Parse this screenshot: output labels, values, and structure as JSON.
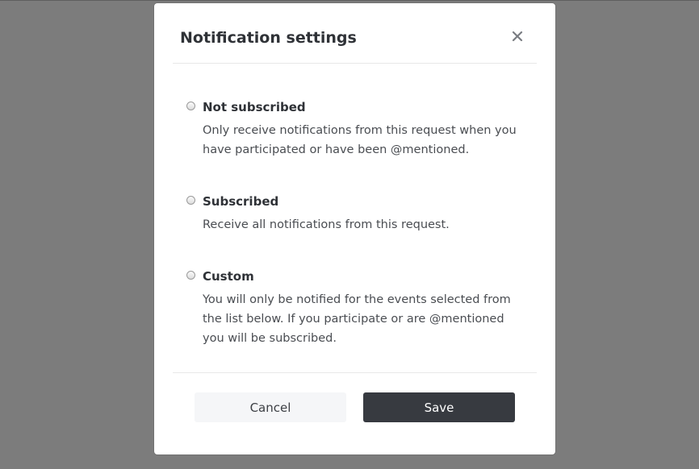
{
  "dialog": {
    "title": "Notification settings",
    "close_icon": "close-icon"
  },
  "options": [
    {
      "label": "Not subscribed",
      "description": "Only receive notifications from this request when you have participated or have been @mentioned.",
      "selected": false
    },
    {
      "label": "Subscribed",
      "description": "Receive all notifications from this request.",
      "selected": false
    },
    {
      "label": "Custom",
      "description": "You will only be notified for the events selected from the list below. If you participate or are @mentioned you will be subscribed.",
      "selected": false
    }
  ],
  "footer": {
    "cancel_label": "Cancel",
    "save_label": "Save"
  },
  "colors": {
    "backdrop": "#7c7c7c",
    "primary_button": "#373a40",
    "secondary_button": "#f5f6f8"
  }
}
